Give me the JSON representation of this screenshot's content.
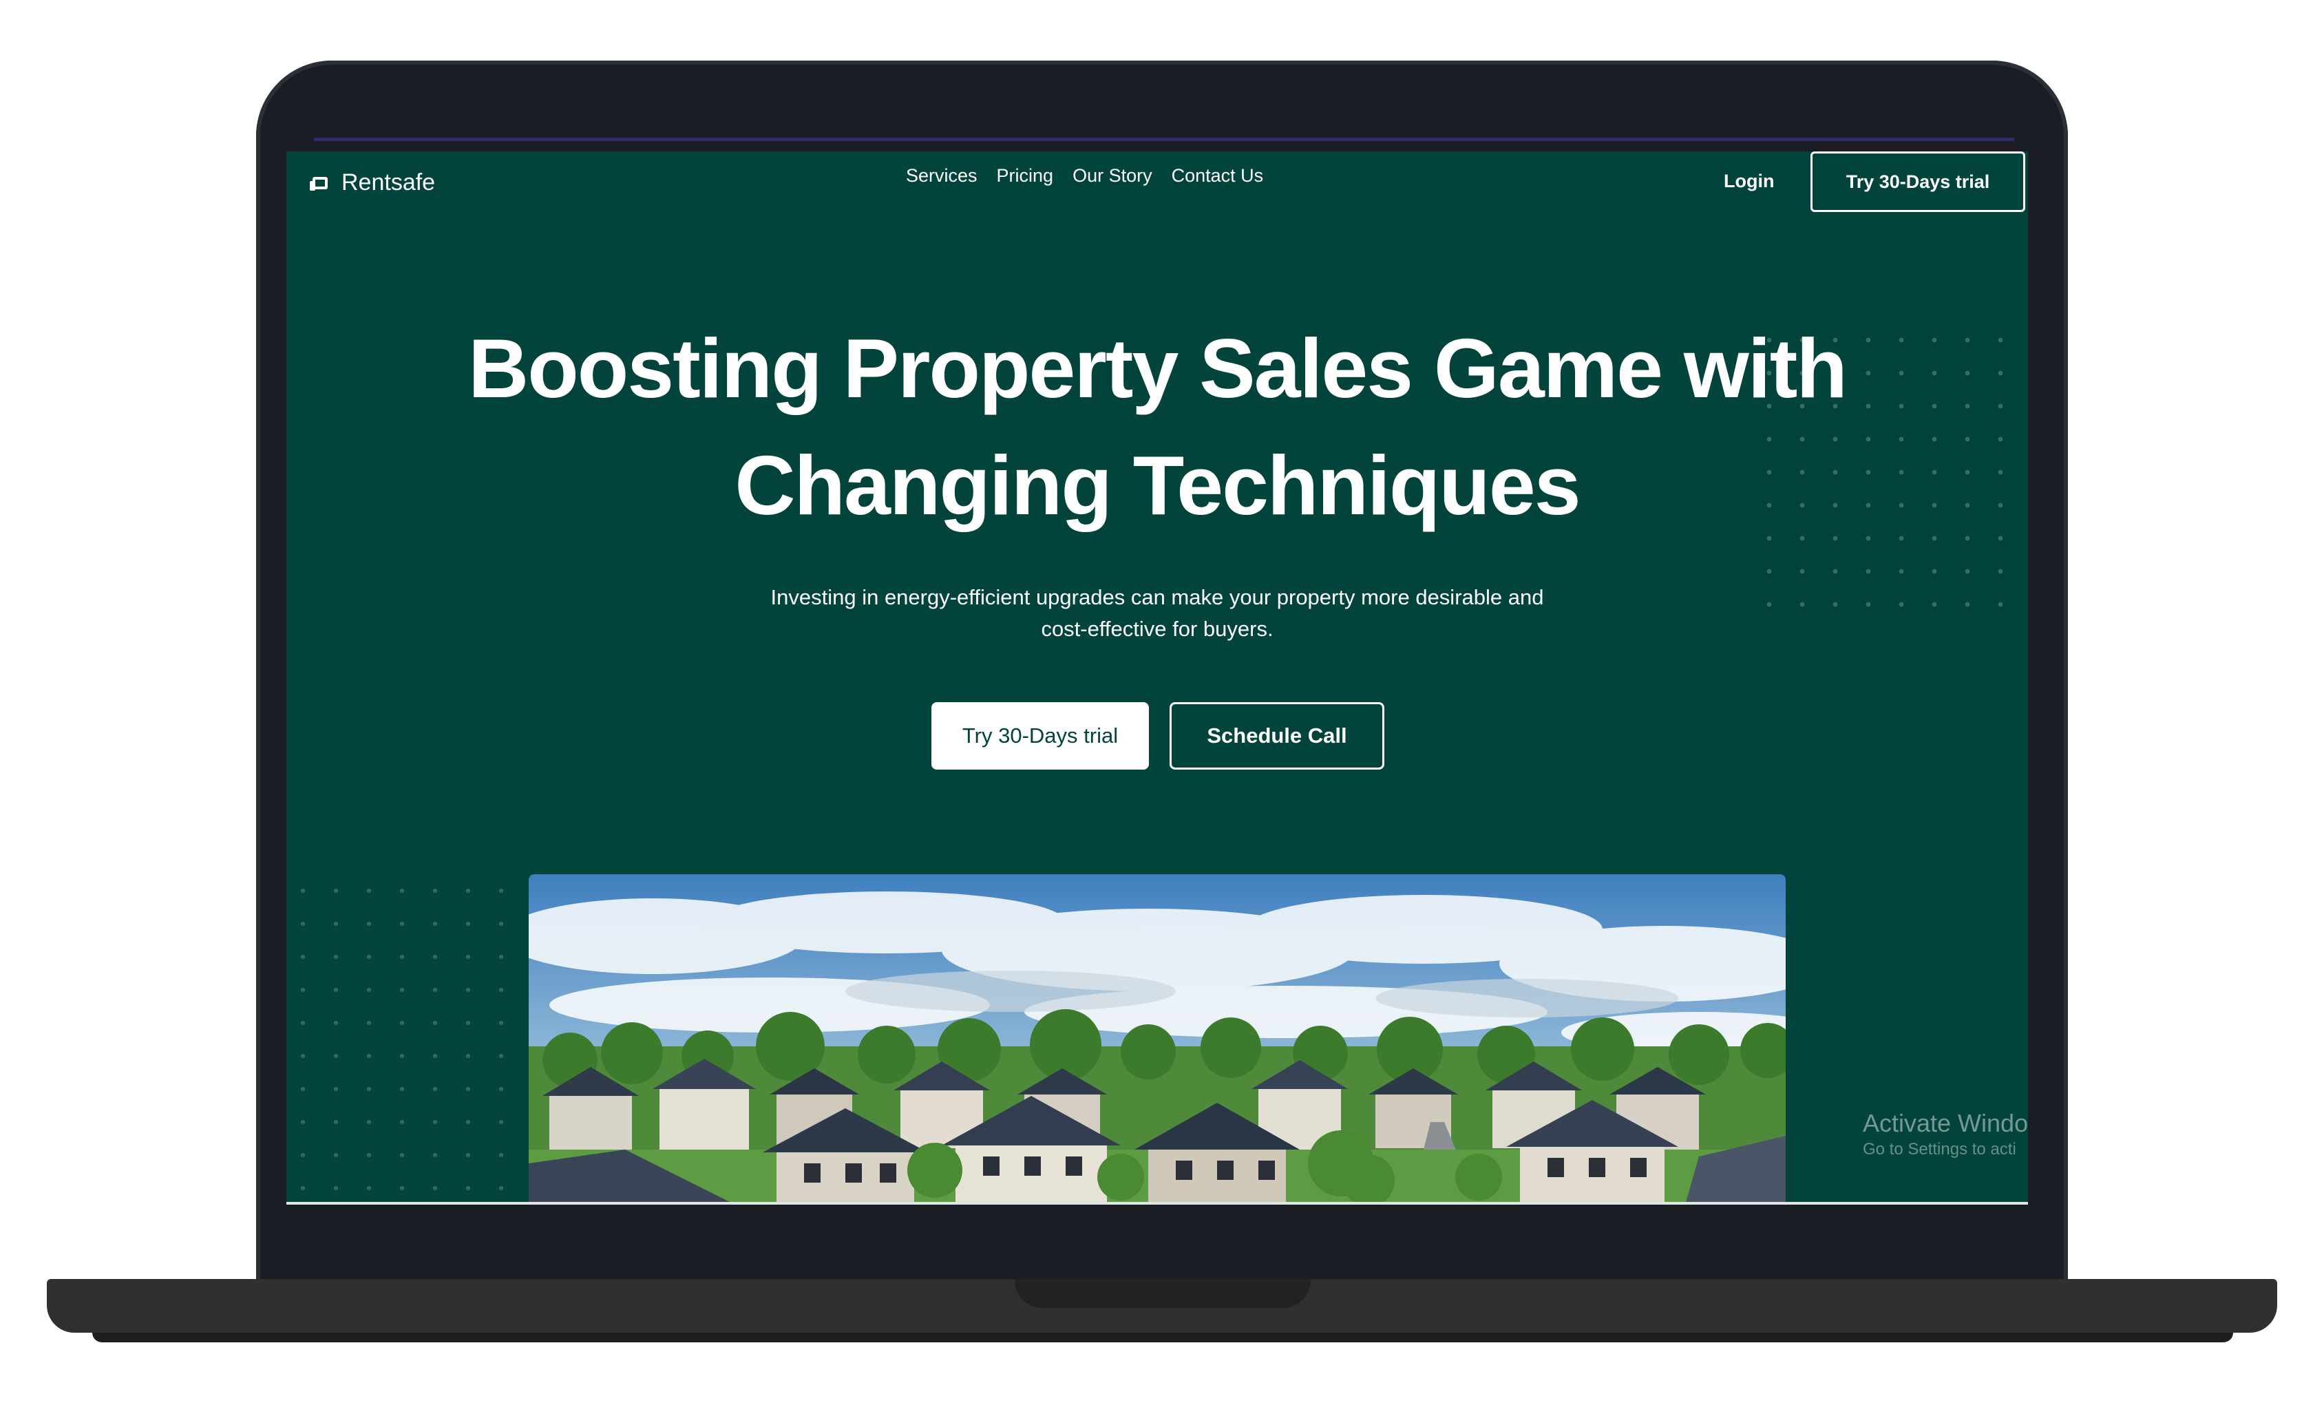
{
  "brand": {
    "name": "Rentsafe",
    "icon": "home-outline-icon"
  },
  "nav": {
    "links": [
      "Services",
      "Pricing",
      "Our Story",
      "Contact Us"
    ],
    "login_label": "Login",
    "cta_label": "Try 30-Days trial"
  },
  "hero": {
    "title_line1": "Boosting Property Sales Game with",
    "title_line2": "Changing Techniques",
    "subtitle_line1": "Investing in energy-efficient upgrades can make your property more desirable and",
    "subtitle_line2": "cost-effective for buyers.",
    "primary_button": "Try 30-Days trial",
    "secondary_button": "Schedule Call"
  },
  "watermark": {
    "title": "Activate Windo",
    "subtitle": "Go to Settings to acti"
  },
  "colors": {
    "background": "#02443b",
    "text": "#ffffff",
    "button_text": "#02443b",
    "laptop_frame": "#1a1e24"
  }
}
